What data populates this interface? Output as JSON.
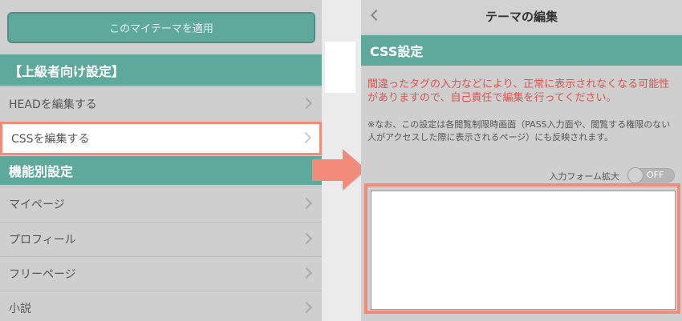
{
  "left": {
    "apply_button": "このマイテーマを適用",
    "advanced_section": "【上級者向け設定】",
    "items_advanced": [
      {
        "label": "HEADを編集する"
      },
      {
        "label": "CSSを編集する"
      }
    ],
    "function_section": "機能別設定",
    "items_function": [
      {
        "label": "マイページ"
      },
      {
        "label": "プロフィール"
      },
      {
        "label": "フリーページ"
      },
      {
        "label": "小説"
      }
    ]
  },
  "right": {
    "title": "テーマの編集",
    "section_title": "CSS設定",
    "warning": "間違ったタグの入力などにより、正常に表示されなくなる可能性がありますので、自己責任で編集を行ってください。",
    "note": "※なお、この設定は各閲覧制限時画面（PASS入力面や、閲覧する権限のない人がアクセスした際に表示されるページ）にも反映されます。",
    "expand_label": "入力フォーム拡大",
    "toggle_state": "OFF",
    "css_value": ""
  },
  "colors": {
    "accent": "#5ea89c",
    "highlight": "#f28b79",
    "warning": "#d9534f"
  },
  "icons": {
    "chevron": "chevron-right-icon",
    "back": "chevron-left-icon",
    "arrow": "arrow-right-icon"
  }
}
